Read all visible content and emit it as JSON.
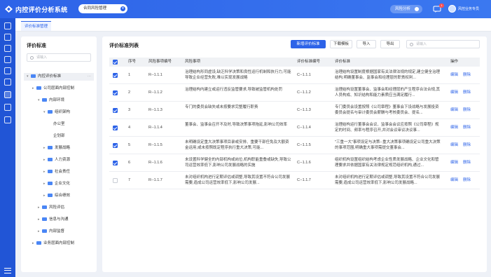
{
  "header": {
    "app_title": "内控评价分析系统",
    "module_select": "合同风险管理",
    "risk_pill": "风险分析",
    "notification_count": "1",
    "username": "风控业务专员"
  },
  "tabs": [
    {
      "label": "评价标准管理"
    }
  ],
  "left_panel": {
    "title": "评价标准",
    "search_placeholder": "请输入",
    "tree": [
      {
        "label": "内控评价标准",
        "arrow": "▾",
        "indent": 0,
        "selected": true,
        "more": "···"
      },
      {
        "label": "公司层面内部控制",
        "arrow": "▸",
        "indent": 1
      },
      {
        "label": "内部环境",
        "arrow": "▾",
        "indent": 2
      },
      {
        "label": "组织架构",
        "arrow": "▾",
        "indent": 3
      },
      {
        "label": "办公室",
        "arrow": "",
        "indent": 4
      },
      {
        "label": "企划部",
        "arrow": "",
        "indent": 4
      },
      {
        "label": "发展战略",
        "arrow": "▸",
        "indent": 3
      },
      {
        "label": "人力资源",
        "arrow": "▸",
        "indent": 3
      },
      {
        "label": "社会责任",
        "arrow": "▸",
        "indent": 3
      },
      {
        "label": "企业文化",
        "arrow": "▸",
        "indent": 3
      },
      {
        "label": "综合绩效",
        "arrow": "▸",
        "indent": 3
      },
      {
        "label": "风险评估",
        "arrow": "▸",
        "indent": 2
      },
      {
        "label": "信息与沟通",
        "arrow": "▸",
        "indent": 2
      },
      {
        "label": "内部监督",
        "arrow": "▸",
        "indent": 2
      },
      {
        "label": "业务层面内部控制",
        "arrow": "▸",
        "indent": 1
      }
    ]
  },
  "main": {
    "title": "评价标准列表",
    "buttons": {
      "add": "新增评价标准",
      "download": "下载模板",
      "import": "导入",
      "export": "导出"
    },
    "search_placeholder": "请输入",
    "columns": [
      "序号",
      "风险事项编号",
      "风险事项",
      "评价标准编号",
      "评价标准",
      "操作"
    ],
    "rows": [
      {
        "checked": true,
        "index": "1",
        "risk_no": "R--1.1.1",
        "risk": "治理结构形同虚设,缺乏科学决策和良性运行机制和执行力,可能导致企业经营失败,难以实现发展战略",
        "std_no": "C--1.1.1",
        "std": "治理结构设置制度根据国家有关法律法规的规定,建立健全治理结构,明确董事会、监事会和经理层的职责权利...",
        "edit": "编辑",
        "del": "删除"
      },
      {
        "checked": true,
        "index": "2",
        "risk_no": "R--1.1.2",
        "risk": "治理结构内建立或运行违反监管要求,导致被监管机构处罚",
        "std_no": "C--1.1.2",
        "std": "治理结构设置董事会、监事会和经理层的产生程序合法合规,其人员构成、知识结构和能力素质应当满足履行...",
        "edit": "编辑",
        "del": "删除"
      },
      {
        "checked": true,
        "index": "3",
        "risk_no": "R--1.1.3",
        "risk": "专门的委员会缺失或未按要求完整履行职责",
        "std_no": "C--1.1.3",
        "std": "专门委员会设置按照《公司章程》董事会下设战略与发展投资委员会提名与审计委员会薪酬与考核委员会、提名...",
        "edit": "编辑",
        "del": "删除"
      },
      {
        "checked": true,
        "index": "4",
        "risk_no": "R--1.1.4",
        "risk": "董事会、监事会召开不及时,导致决策事项拖延,影响公司效率",
        "std_no": "C--1.1.4",
        "std": "治理结构运行董事会会议、监事会会议应按照《公司章程》规定的时间、频率与程序召开,并对会议审议决议事...",
        "edit": "编辑",
        "del": "删除"
      },
      {
        "checked": true,
        "index": "5",
        "risk_no": "R--1.1.5",
        "risk": "未明确设定重大决策事项目录或安排、重要干部任免及大额资金运用,或未按照既定程序执行重大决策,可能...",
        "std_no": "C--1.1.5",
        "std": "\"三重一大\"事项设定与决策--重大决策事项确设定公司重大决策的事项范围,明确重大事项需提交董事会...",
        "edit": "编辑",
        "del": "删除"
      },
      {
        "checked": true,
        "index": "6",
        "risk_no": "R--1.1.6",
        "risk": "未设置科学健全的内部机构或岗位,机构职能重叠或缺失,导致公司运营效率低下,影响公司发展战略的实施",
        "std_no": "C--1.1.6",
        "std": "组织机构设置组织结构考虑企业性质发展战略、企业文化和管理要求并依据国家有关法律规定规范组织机构,通过...",
        "edit": "编辑",
        "del": "删除"
      },
      {
        "checked": false,
        "index": "7",
        "risk_no": "R--1.1.7",
        "risk": "未对组织机构进行定期评估或调整,导致其设置不符合公司发展需要,造成公司运营效率低下,影响公司发展...",
        "std_no": "C--1.1.7",
        "std": "未对组织机构进行定期评估或调整,导致其设置不符合公司发展需要,造成公司运营效率低下,影响公司发展战略...",
        "edit": "编辑",
        "del": "删除"
      }
    ]
  },
  "colors": {
    "primary": "#2d63e8",
    "nav": "#2155d6"
  }
}
